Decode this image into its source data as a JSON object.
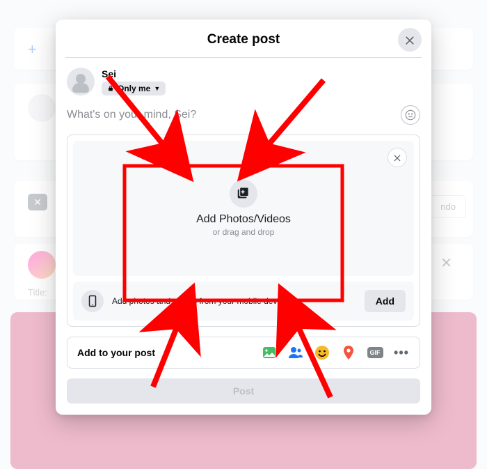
{
  "modal": {
    "title": "Create post",
    "author": {
      "name": "Sei",
      "privacy_label": "Only me"
    },
    "composer": {
      "placeholder": "What's on your mind, Sei?"
    },
    "drop": {
      "title": "Add Photos/Videos",
      "sub": "or drag and drop"
    },
    "mobile": {
      "text": "Add photos and videos from your mobile device.",
      "button": "Add"
    },
    "attach": {
      "label": "Add to your post",
      "gif": "GIF"
    },
    "post_button": "Post"
  },
  "background": {
    "pill_right": "ndo",
    "title_label": "Title:"
  }
}
